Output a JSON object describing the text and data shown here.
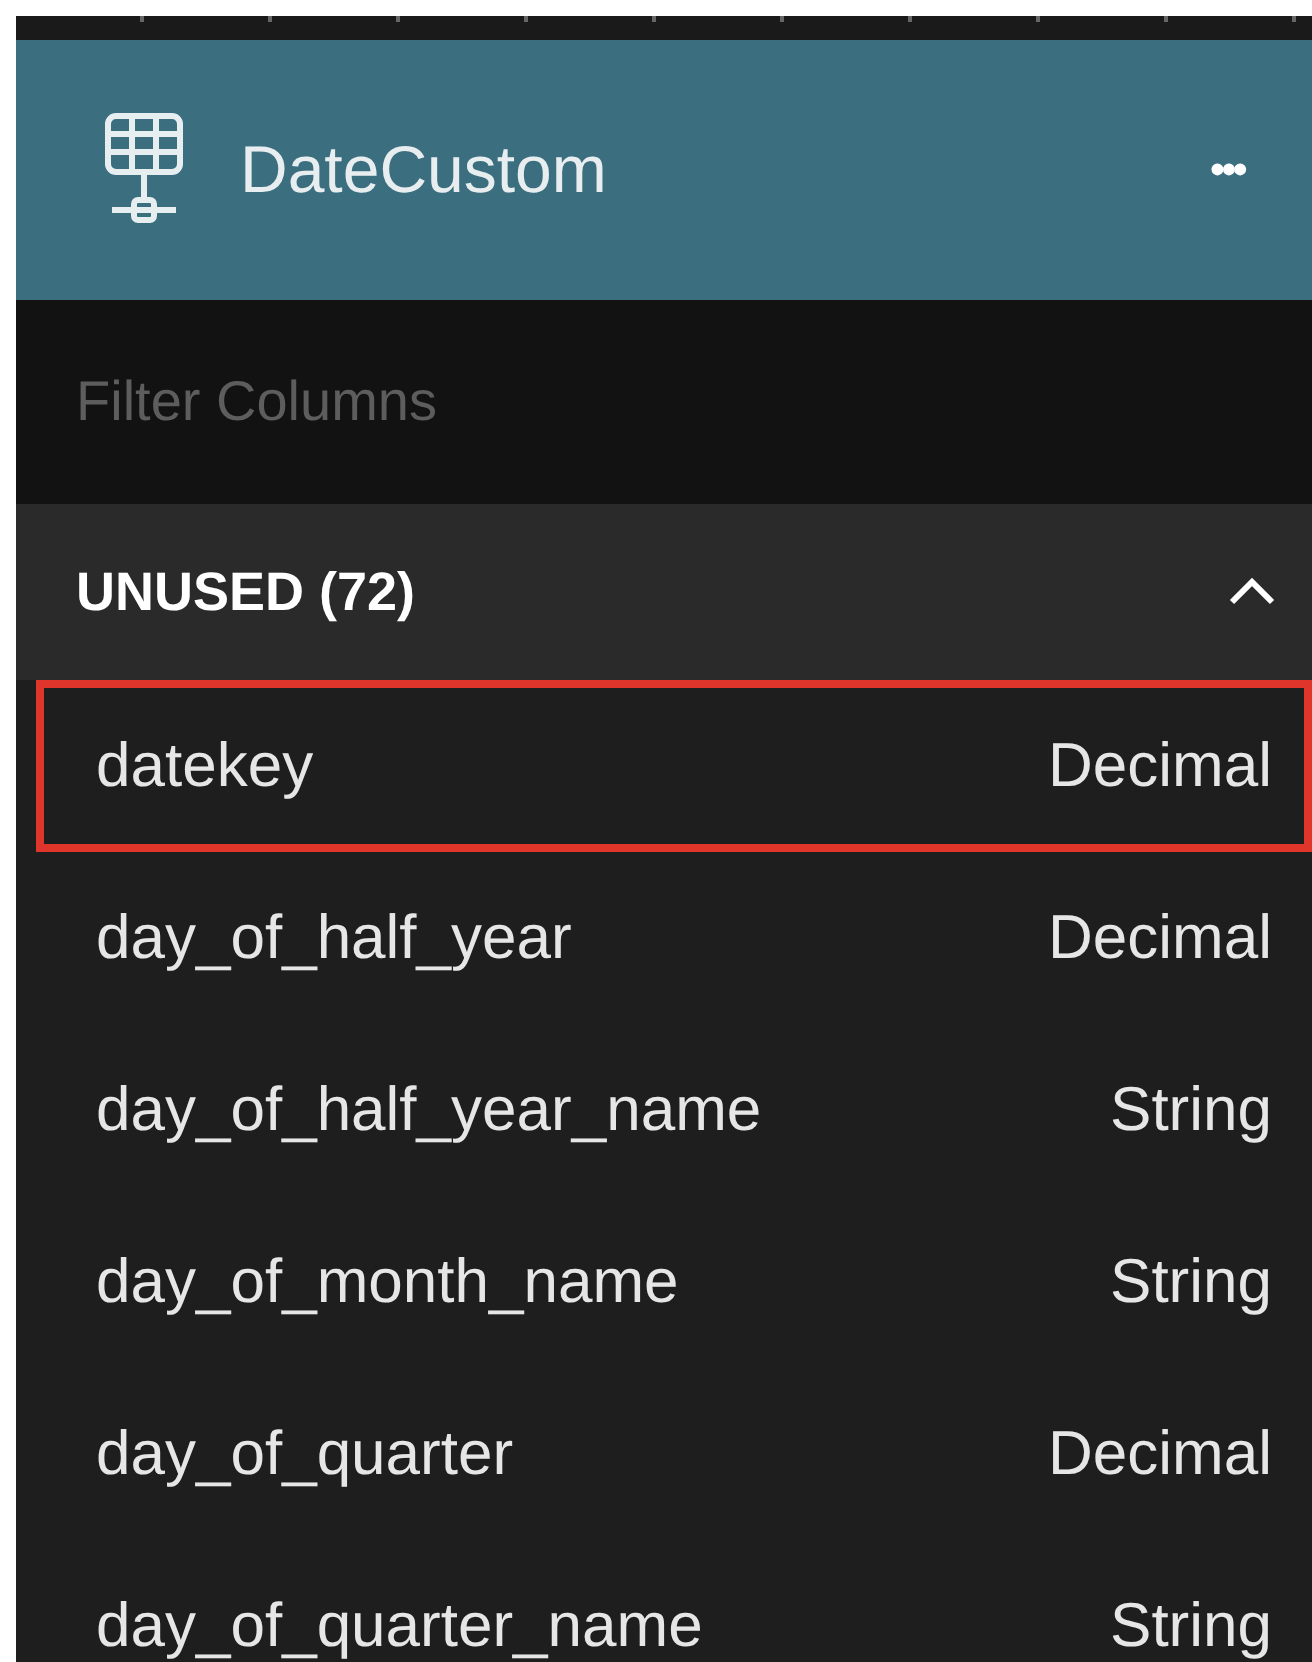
{
  "header": {
    "title": "DateCustom",
    "menu": "•••"
  },
  "filter": {
    "placeholder": "Filter Columns"
  },
  "section": {
    "title": "UNUSED (72)",
    "expanded": true
  },
  "columns": [
    {
      "name": "datekey",
      "type": "Decimal",
      "selected": true
    },
    {
      "name": "day_of_half_year",
      "type": "Decimal",
      "selected": false
    },
    {
      "name": "day_of_half_year_name",
      "type": "String",
      "selected": false
    },
    {
      "name": "day_of_month_name",
      "type": "String",
      "selected": false
    },
    {
      "name": "day_of_quarter",
      "type": "Decimal",
      "selected": false
    },
    {
      "name": "day_of_quarter_name",
      "type": "String",
      "selected": false
    }
  ]
}
